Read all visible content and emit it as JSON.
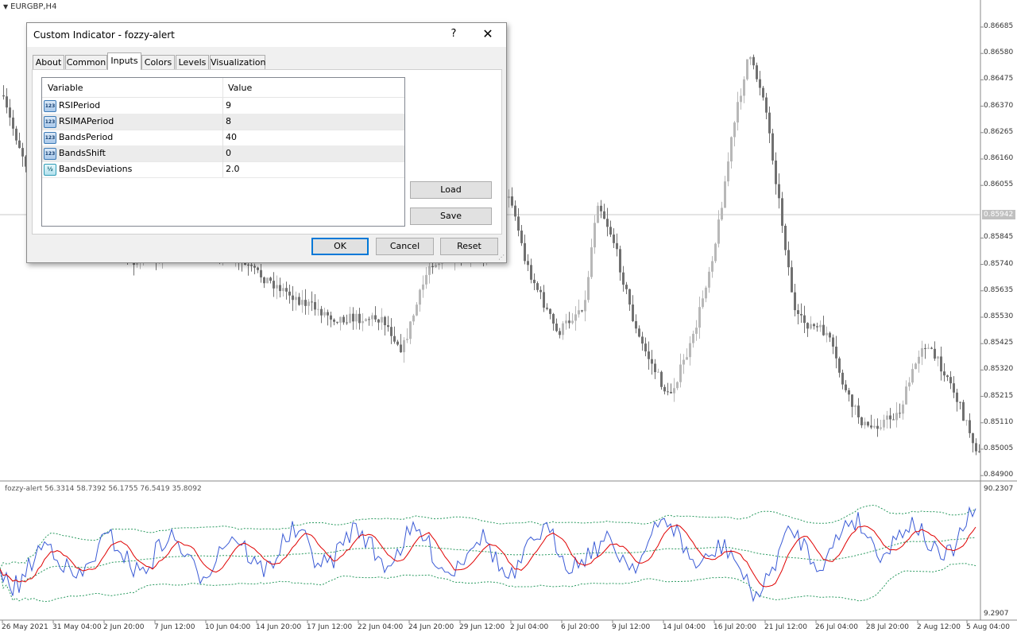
{
  "chart": {
    "symbol": "EURGBP,H4",
    "current_price": "0.85942",
    "price_scale": [
      "0.86685",
      "0.86580",
      "0.86475",
      "0.86370",
      "0.86265",
      "0.86160",
      "0.86055",
      "0.85845",
      "0.85740",
      "0.85635",
      "0.85530",
      "0.85425",
      "0.85320",
      "0.85215",
      "0.85110",
      "0.85005",
      "0.84900"
    ],
    "indicator_title": "fozzy-alert 56.3314 58.7392 56.1755 76.5419 35.8092",
    "indicator_scale": {
      "max": "90.2307",
      "min": "9.2907"
    },
    "dates": [
      "26 May 2021",
      "31 May 04:00",
      "2 Jun 20:00",
      "7 Jun 12:00",
      "10 Jun 04:00",
      "14 Jun 20:00",
      "17 Jun 12:00",
      "22 Jun 04:00",
      "24 Jun 20:00",
      "29 Jun 12:00",
      "2 Jul 04:00",
      "6 Jul 20:00",
      "9 Jul 12:00",
      "14 Jul 04:00",
      "16 Jul 20:00",
      "21 Jul 12:00",
      "26 Jul 04:00",
      "28 Jul 20:00",
      "2 Aug 12:00",
      "5 Aug 04:00"
    ],
    "colors": {
      "candle_bear": "#707070",
      "candle_bull": "#b8b8b8",
      "rsi": "#3b5bd6",
      "rsi_ma": "#e00000",
      "bands": "#2a9a60"
    }
  },
  "dialog": {
    "title": "Custom Indicator - fozzy-alert",
    "help": "?",
    "close": "✕",
    "tabs": [
      "About",
      "Common",
      "Inputs",
      "Colors",
      "Levels",
      "Visualization"
    ],
    "active_tab": "Inputs",
    "table": {
      "headers": {
        "variable": "Variable",
        "value": "Value"
      },
      "rows": [
        {
          "icon": "123",
          "name": "RSIPeriod",
          "value": "9"
        },
        {
          "icon": "123",
          "name": "RSIMAPeriod",
          "value": "8"
        },
        {
          "icon": "123",
          "name": "BandsPeriod",
          "value": "40"
        },
        {
          "icon": "123",
          "name": "BandsShift",
          "value": "0"
        },
        {
          "icon": "½",
          "name": "BandsDeviations",
          "value": "2.0"
        }
      ]
    },
    "buttons": {
      "load": "Load",
      "save": "Save",
      "ok": "OK",
      "cancel": "Cancel",
      "reset": "Reset"
    }
  }
}
